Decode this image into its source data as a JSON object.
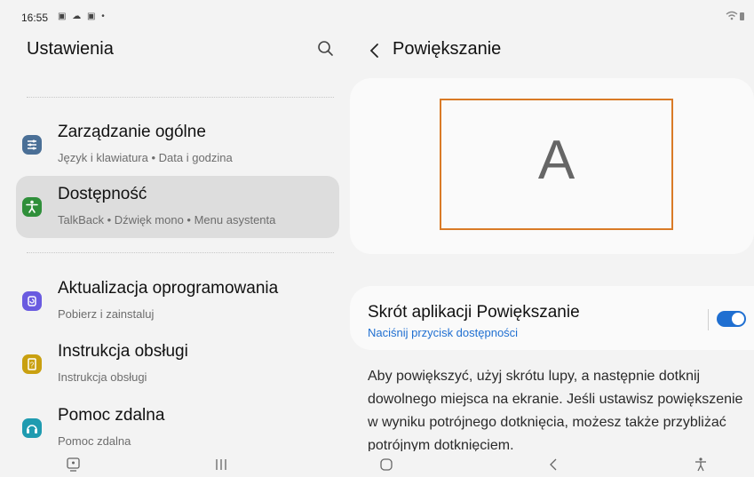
{
  "status_bar": {
    "time": "16:55",
    "icons": "▣ ☁ ▣ •",
    "right_icons": "wifi battery"
  },
  "left_panel": {
    "title": "Ustawienia",
    "items": [
      {
        "title": "Zarządzanie ogólne",
        "subtitle": "Język i klawiatura • Data i godzina",
        "icon": "sliders-icon",
        "color": "#4a6f96"
      },
      {
        "title": "Dostępność",
        "subtitle": "TalkBack • Dźwięk mono • Menu asystenta",
        "icon": "accessibility-icon",
        "color": "#2f8f3a",
        "active": true
      },
      {
        "title": "Aktualizacja oprogramowania",
        "subtitle": "Pobierz i zainstaluj",
        "icon": "update-icon",
        "color": "#6a5be0"
      },
      {
        "title": "Instrukcja obsługi",
        "subtitle": "Instrukcja obsługi",
        "icon": "manual-icon",
        "color": "#c9a010"
      },
      {
        "title": "Pomoc zdalna",
        "subtitle": "Pomoc zdalna",
        "icon": "headset-icon",
        "color": "#1f9bb0"
      }
    ]
  },
  "right_panel": {
    "title": "Powiększanie",
    "preview_letter": "A",
    "shortcut": {
      "title": "Skrót aplikacji Powiększanie",
      "subtitle": "Naciśnij przycisk dostępności",
      "enabled": true
    },
    "description": "Aby powiększyć, użyj skrótu lupy, a następnie dotknij dowolnego miejsca na ekranie. Jeśli ustawisz powiększenie w wyniku potrójnego dotknięcia, możesz także przybliżać potrójnym dotknięciem."
  },
  "colors": {
    "accent": "#1f6fd1",
    "highlight": "#d97a26",
    "active_bg": "#dddddd"
  },
  "nav_bar": {
    "buttons": [
      "screenshot-icon",
      "recents-icon",
      "home-icon",
      "back-icon",
      "accessibility-icon"
    ]
  }
}
